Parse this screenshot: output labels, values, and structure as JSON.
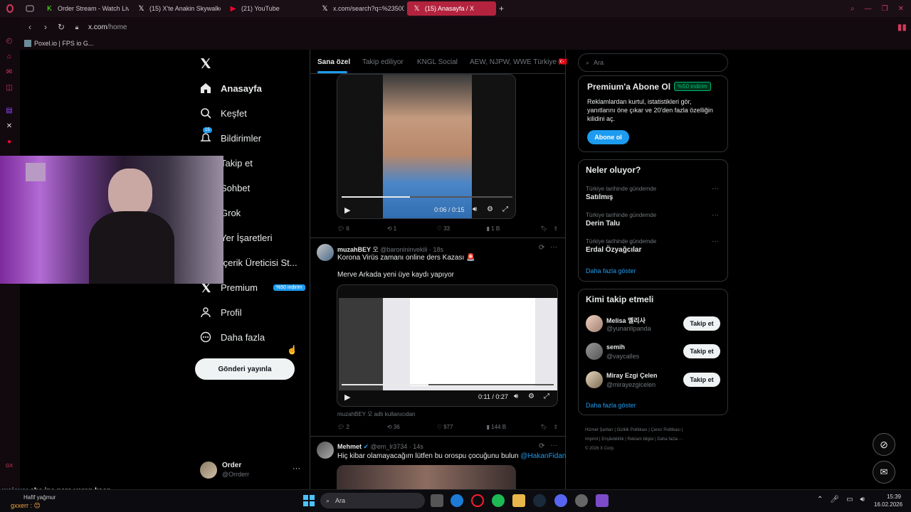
{
  "browser": {
    "tabs": [
      {
        "label": "Order Stream - Watch Live",
        "icon": "kick-icon",
        "icon_glyph": "K",
        "color": "#53fc18"
      },
      {
        "label": "(15) X'te Anakin Skywalker",
        "icon": "x-icon",
        "icon_glyph": "𝕏",
        "color": "#ffffff"
      },
      {
        "label": "(21) YouTube",
        "icon": "youtube-icon",
        "icon_glyph": "▶",
        "color": "#ff0033"
      },
      {
        "label": "x.com/search?q=%23500",
        "icon": "x-icon",
        "icon_glyph": "𝕏",
        "color": "#ffffff"
      },
      {
        "label": "(15) Anasayfa / X",
        "icon": "x-icon",
        "icon_glyph": "𝕏",
        "color": "#ffffff",
        "active": true
      }
    ],
    "new_tab": "+",
    "url_host": "x.com",
    "url_path": "/home",
    "bookmark": "Poxel.io | FPS io G..."
  },
  "nav": {
    "items": [
      {
        "label": "Anasayfa",
        "icon": "home-icon",
        "bold": true
      },
      {
        "label": "Keşfet",
        "icon": "search-icon"
      },
      {
        "label": "Bildirimler",
        "icon": "bell-icon",
        "badge": "15"
      },
      {
        "label": "Takip et",
        "icon": "person-add-icon"
      },
      {
        "label": "Sohbet",
        "icon": "mail-icon"
      },
      {
        "label": "Grok",
        "icon": "grok-icon"
      },
      {
        "label": "Yer İşaretleri",
        "icon": "bookmark-icon"
      },
      {
        "label": "İçerik Üreticisi St...",
        "icon": "lightning-icon"
      },
      {
        "label": "Premium",
        "icon": "x-logo-icon",
        "badge": "%50 indirim"
      },
      {
        "label": "Profil",
        "icon": "profile-icon"
      },
      {
        "label": "Daha fazla",
        "icon": "more-circle-icon"
      }
    ],
    "post_button": "Gönderi yayınla",
    "account": {
      "name": "Order",
      "handle": "@Orrderr"
    }
  },
  "feed": {
    "tabs": [
      "Sana özel",
      "Takip ediliyor",
      "KNGL Social",
      "AEW, NJPW, WWE Türkiye 🇹🇷"
    ],
    "tweet1": {
      "video_time": "0:06 / 0:15",
      "video_progress": 0.4,
      "replies": "6",
      "retweets": "1",
      "likes": "33",
      "views": "1 B"
    },
    "tweet2": {
      "name": "muzahBEY",
      "handle": "@baronininvekili",
      "time": "18s",
      "text1": "Korona Virüs zamanı online ders Kazası 🚨",
      "text2": "Merve Arkada yeni üye kaydı yapıyor",
      "video_time": "0:11 / 0:27",
      "video_progress": 0.41,
      "credit": "muzahBEY 오 adlı kullanıcıdan",
      "replies": "2",
      "retweets": "36",
      "likes": "977",
      "views": "144 B"
    },
    "tweet3": {
      "name": "Mehmet",
      "handle": "@em_lr3734",
      "time": "14s",
      "text": "Hiç kibar olamayacağım lütfen bu orospu çocuğunu bulun",
      "mention": "@HakanFidan"
    }
  },
  "right": {
    "search_placeholder": "Ara",
    "premium": {
      "title": "Premium'a Abone Ol",
      "badge": "%50 indirim",
      "text1": "Reklamlardan kurtul, istatistikleri gör,",
      "text2": "yanıtlarını öne çıkar ve 20'den fazla özelliğin",
      "text3": "kilidini aç.",
      "button": "Abone ol"
    },
    "trends": {
      "title": "Neler oluyor?",
      "items": [
        {
          "ctx": "Türkiye tarihinde gündemde",
          "name": "Satılmış"
        },
        {
          "ctx": "Türkiye tarihinde gündemde",
          "name": "Derin Talu"
        },
        {
          "ctx": "Türkiye tarihinde gündemde",
          "name": "Erdal Özyağcılar"
        }
      ],
      "more": "Daha fazla göster"
    },
    "who": {
      "title": "Kimi takip etmeli",
      "items": [
        {
          "name": "Melisa 멜리사",
          "handle": "@yunanlipanda",
          "button": "Takip et"
        },
        {
          "name": "semih",
          "handle": "@vaycalles",
          "button": "Takip et"
        },
        {
          "name": "Miray Ezgi Çelen",
          "handle": "@mirayezgicelen",
          "button": "Takip et"
        }
      ],
      "more": "Daha fazla göster"
    },
    "footer": {
      "l1": [
        "Hizmet Şartları",
        "Gizlilik Politikası",
        "Çerez Politikası"
      ],
      "l2": [
        "Imprint",
        "Erişilebilirlik",
        "Reklam bilgisi",
        "Daha fazla ···"
      ],
      "copy": "© 2026 X Corp."
    }
  },
  "overlay": {
    "chat_user": "wojexs",
    "chat_text": ": aha ipe para veren kaan",
    "chat2_user": "gxxerr",
    "weather": "Hafif yağmur"
  },
  "taskbar": {
    "search": "Ara",
    "time": "15:39",
    "date": "16.02.2026"
  }
}
